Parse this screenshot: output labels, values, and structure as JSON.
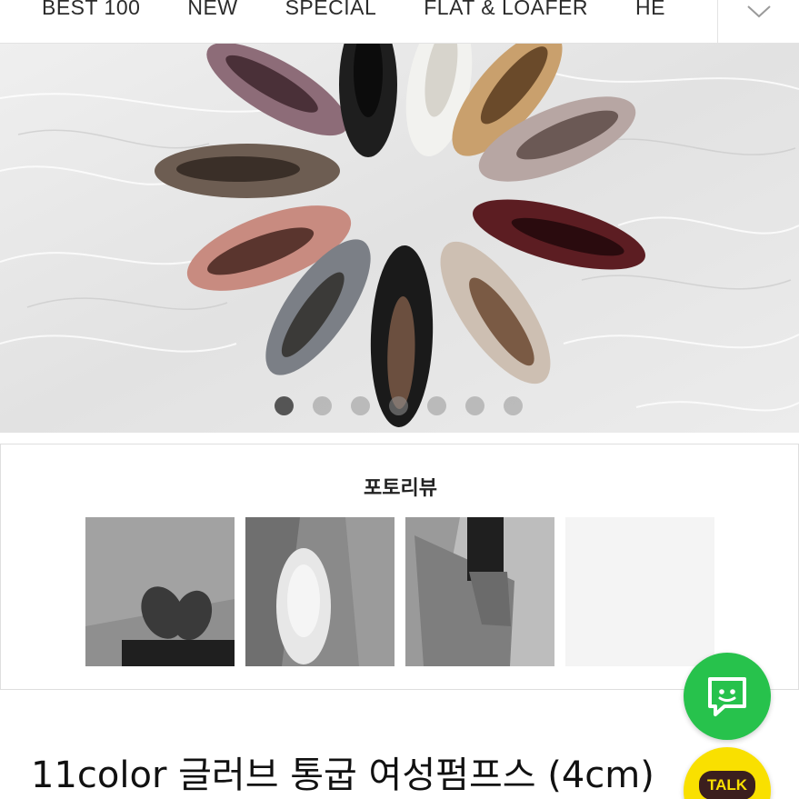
{
  "nav": {
    "items": [
      "BEST 100",
      "NEW",
      "SPECIAL",
      "FLAT & LOAFER",
      "HE"
    ],
    "more_icon": "chevron-down-icon"
  },
  "hero": {
    "slide_count": 7,
    "active_index": 0,
    "shoe_colors": [
      "#8d6c78",
      "#1e1e1e",
      "#f2f2ef",
      "#c9a06d",
      "#b7a6a3",
      "#6d5d52",
      "#5c1d22",
      "#c88b80",
      "#7b7f86",
      "#1a1a1a",
      "#cdbfb2"
    ]
  },
  "review": {
    "title": "포토리뷰"
  },
  "product": {
    "title": "11color 글러브 통굽 여성펌프스 (4cm)"
  },
  "fab": {
    "chat_icon": "chat-icon",
    "talk_label": "TALK"
  }
}
